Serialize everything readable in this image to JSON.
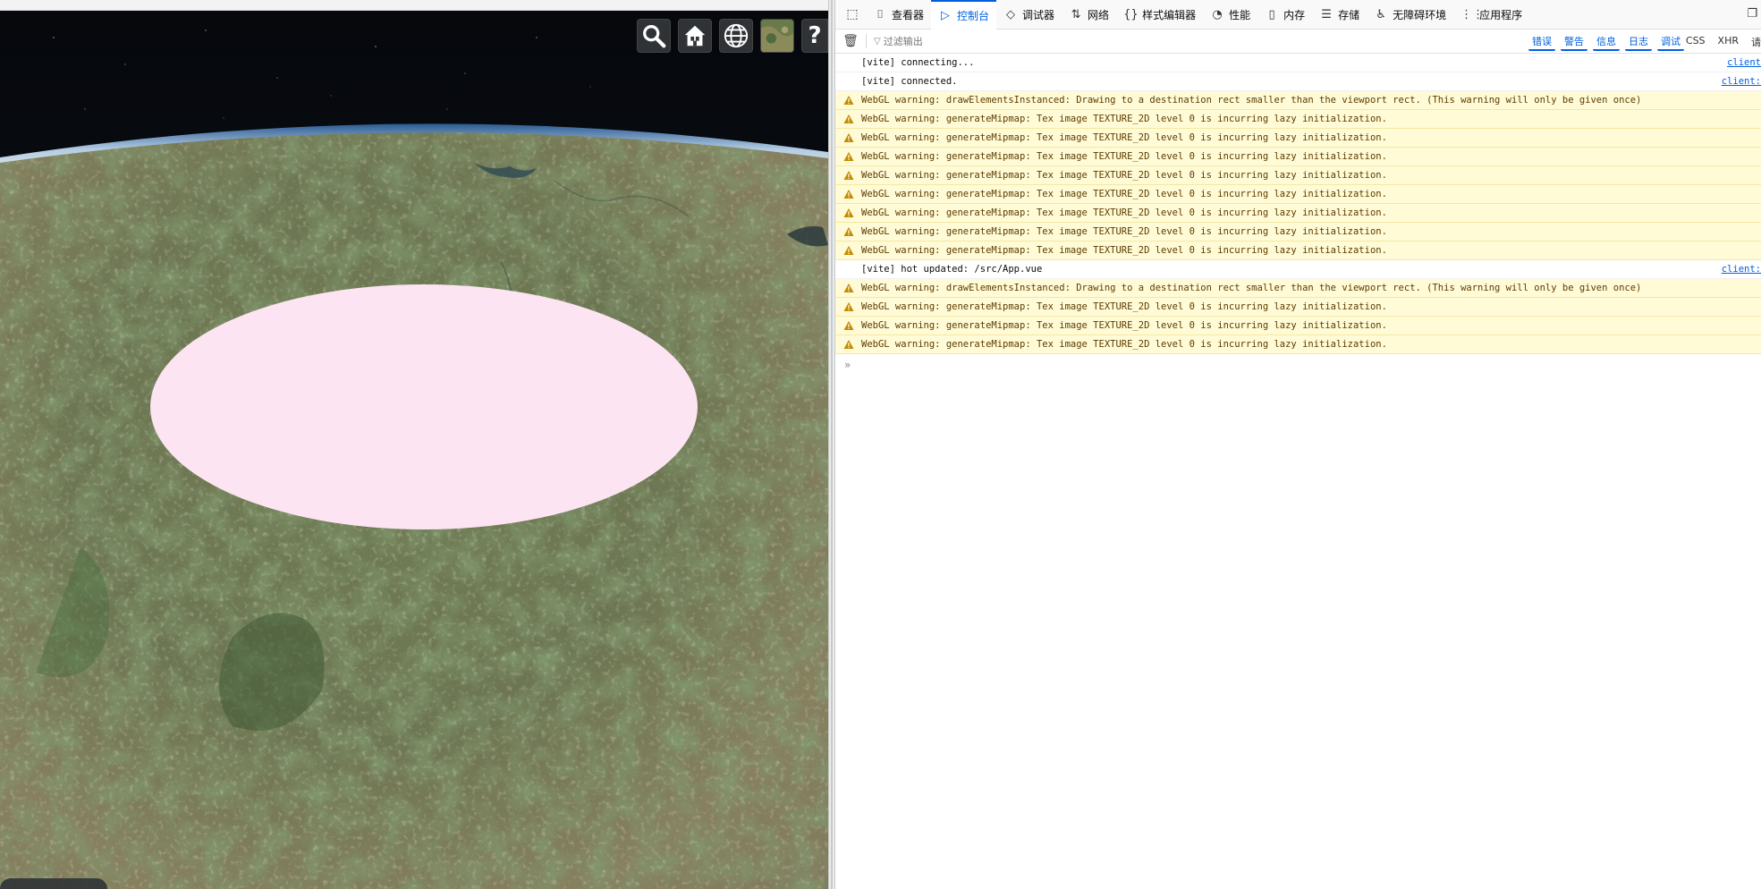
{
  "viewer": {
    "toolbar": {
      "search_icon": "search-icon",
      "home_icon": "home-icon",
      "globe_icon": "globe-icon",
      "help_label": "?"
    }
  },
  "devtools": {
    "tabs": [
      {
        "label": "查看器",
        "icon": "⌷"
      },
      {
        "label": "控制台",
        "icon": "▷",
        "active": true
      },
      {
        "label": "调试器",
        "icon": "◇"
      },
      {
        "label": "网络",
        "icon": "⇅"
      },
      {
        "label": "样式编辑器",
        "icon": "{}"
      },
      {
        "label": "性能",
        "icon": "◔"
      },
      {
        "label": "内存",
        "icon": "▯"
      },
      {
        "label": "存储",
        "icon": "☰"
      },
      {
        "label": "无障碍环境",
        "icon": "♿"
      },
      {
        "label": "应用程序",
        "icon": "⋮⋮"
      }
    ],
    "filter": {
      "placeholder": "过滤输出"
    },
    "levels": [
      "错误",
      "警告",
      "信息",
      "日志",
      "调试"
    ],
    "requests": [
      "CSS",
      "XHR",
      "请"
    ],
    "prompt": "»",
    "messages": [
      {
        "type": "log",
        "text": "[vite] connecting...",
        "source": "client"
      },
      {
        "type": "log",
        "text": "[vite] connected.",
        "source": "client:"
      },
      {
        "type": "warn",
        "text": "WebGL warning: drawElementsInstanced: Drawing to a destination rect smaller than the viewport rect. (This warning will only be given once)"
      },
      {
        "type": "warn",
        "text": "WebGL warning: generateMipmap: Tex image TEXTURE_2D level 0 is incurring lazy initialization."
      },
      {
        "type": "warn",
        "text": "WebGL warning: generateMipmap: Tex image TEXTURE_2D level 0 is incurring lazy initialization."
      },
      {
        "type": "warn",
        "text": "WebGL warning: generateMipmap: Tex image TEXTURE_2D level 0 is incurring lazy initialization."
      },
      {
        "type": "warn",
        "text": "WebGL warning: generateMipmap: Tex image TEXTURE_2D level 0 is incurring lazy initialization."
      },
      {
        "type": "warn",
        "text": "WebGL warning: generateMipmap: Tex image TEXTURE_2D level 0 is incurring lazy initialization."
      },
      {
        "type": "warn",
        "text": "WebGL warning: generateMipmap: Tex image TEXTURE_2D level 0 is incurring lazy initialization."
      },
      {
        "type": "warn",
        "text": "WebGL warning: generateMipmap: Tex image TEXTURE_2D level 0 is incurring lazy initialization."
      },
      {
        "type": "warn",
        "text": "WebGL warning: generateMipmap: Tex image TEXTURE_2D level 0 is incurring lazy initialization."
      },
      {
        "type": "log",
        "text": "[vite] hot updated: /src/App.vue",
        "source": "client:"
      },
      {
        "type": "warn",
        "text": "WebGL warning: drawElementsInstanced: Drawing to a destination rect smaller than the viewport rect. (This warning will only be given once)"
      },
      {
        "type": "warn",
        "text": "WebGL warning: generateMipmap: Tex image TEXTURE_2D level 0 is incurring lazy initialization."
      },
      {
        "type": "warn",
        "text": "WebGL warning: generateMipmap: Tex image TEXTURE_2D level 0 is incurring lazy initialization."
      },
      {
        "type": "warn",
        "text": "WebGL warning: generateMipmap: Tex image TEXTURE_2D level 0 is incurring lazy initialization."
      }
    ]
  },
  "colors": {
    "accent": "#0061e0",
    "warn_bg": "#fffbd6",
    "ellipse": "#fde4f2"
  }
}
